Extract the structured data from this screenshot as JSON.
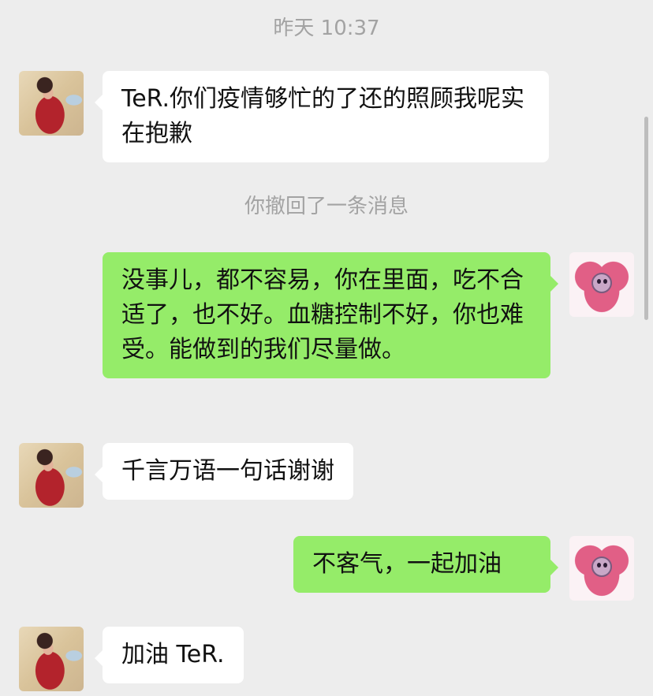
{
  "chat": {
    "timestamp": "昨天 10:37",
    "system_note": "你撤回了一条消息",
    "messages": [
      {
        "side": "left",
        "text": "TeR.你们疫情够忙的了还的照顾我呢实在抱歉"
      },
      {
        "side": "right",
        "text": "没事儿，都不容易，你在里面，吃不合适了，也不好。血糖控制不好，你也难受。能做到的我们尽量做。"
      },
      {
        "side": "left",
        "text": "千言万语一句话谢谢"
      },
      {
        "side": "right",
        "text": "不客气，一起加油"
      },
      {
        "side": "left",
        "text": "加油 TeR."
      }
    ]
  },
  "colors": {
    "background": "#ededed",
    "incoming_bubble": "#ffffff",
    "outgoing_bubble": "#95ec69",
    "meta_text": "#a3a3a3"
  },
  "icons": {
    "contact_avatar": "photo-avatar",
    "self_avatar": "cartoon-heart-avatar"
  }
}
